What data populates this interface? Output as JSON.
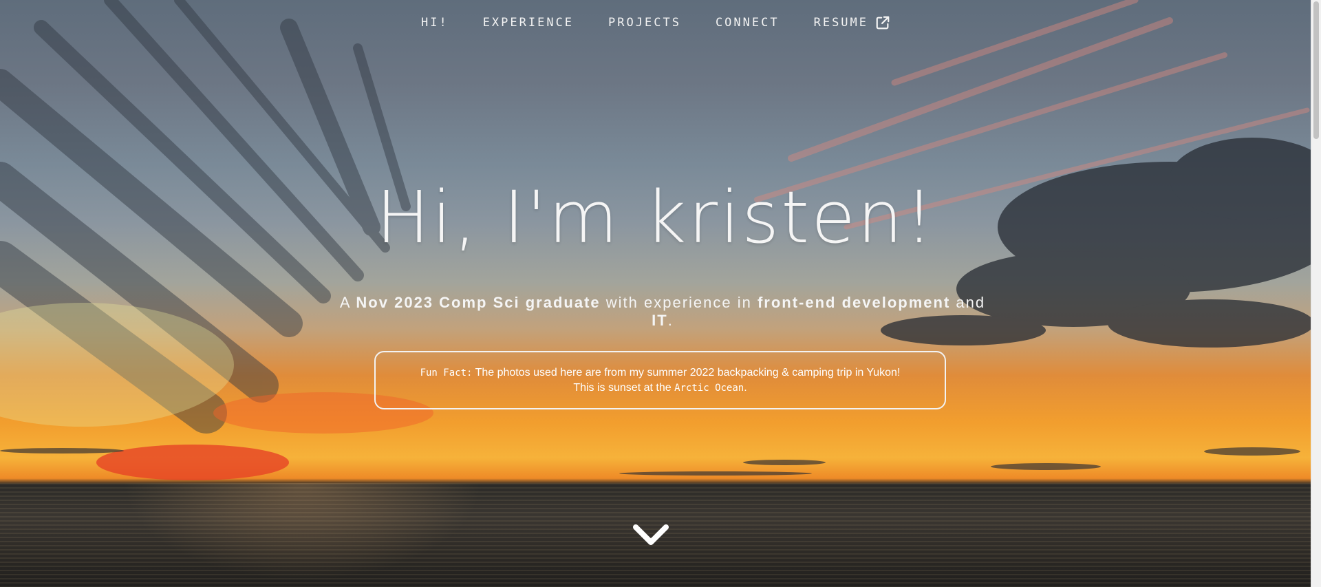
{
  "nav": {
    "items": [
      {
        "label": "Hi!"
      },
      {
        "label": "Experience"
      },
      {
        "label": "Projects"
      },
      {
        "label": "Connect"
      },
      {
        "label": "Resume",
        "icon": "external-link-icon"
      }
    ]
  },
  "hero": {
    "title": "Hi, I'm kristen!",
    "subtitle": {
      "p1": "A ",
      "b1": "Nov 2023 Comp Sci graduate",
      "p2": " with experience in ",
      "b2": "front-end development",
      "p3": " and ",
      "b3": "IT",
      "p4": "."
    }
  },
  "fun_fact": {
    "tag": "Fun Fact:",
    "line1": " The photos used here are from my summer 2022 backpacking & camping trip in Yukon!",
    "line2_pre": "This is sunset at the ",
    "line2_place": "Arctic Ocean",
    "line2_post": "."
  },
  "scroll": {
    "icon": "chevron-down-icon"
  },
  "colors": {
    "text": "#f5f5f5",
    "sunset_orange": "#f29e2e",
    "water": "#2d2a26"
  }
}
